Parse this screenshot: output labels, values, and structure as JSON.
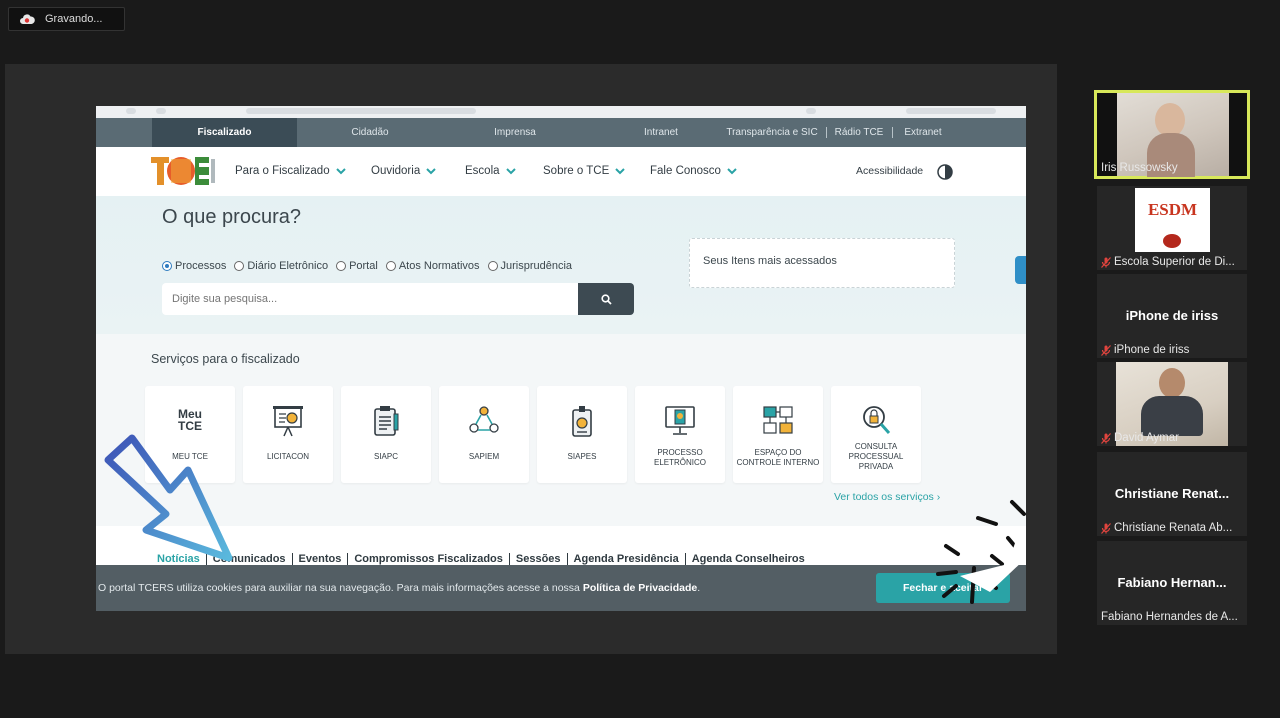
{
  "recording": {
    "label": "Gravando..."
  },
  "topnav": {
    "items": [
      "Fiscalizado",
      "Cidadão",
      "Imprensa",
      "Intranet",
      "Transparência e SIC",
      "Rádio TCE",
      "Extranet"
    ],
    "active": "Fiscalizado"
  },
  "mainnav": {
    "items": [
      "Para o Fiscalizado",
      "Ouvidoria",
      "Escola",
      "Sobre o TCE",
      "Fale Conosco"
    ],
    "accessibility": "Acessibilidade"
  },
  "hero": {
    "title": "O que procura?",
    "search_types": [
      "Processos",
      "Diário Eletrônico",
      "Portal",
      "Atos Normativos",
      "Jurisprudência"
    ],
    "selected_type": "Processos",
    "search_placeholder": "Digite sua pesquisa...",
    "favorites_title": "Seus Itens mais acessados"
  },
  "services": {
    "title": "Serviços para o fiscalizado",
    "cards": [
      "MEU TCE",
      "LICITACON",
      "SIAPC",
      "SAPIEM",
      "SIAPES",
      "PROCESSO ELETRÔNICO",
      "ESPAÇO DO CONTROLE INTERNO",
      "CONSULTA PROCESSUAL PRIVADA"
    ],
    "meu_tce_logo": "Meu TCE",
    "see_all": "Ver todos os serviços ›"
  },
  "news": {
    "tabs": [
      "Notícias",
      "Comunicados",
      "Eventos",
      "Compromissos Fiscalizados",
      "Sessões",
      "Agenda Presidência",
      "Agenda Conselheiros"
    ],
    "active": "Notícias"
  },
  "cookie": {
    "text": "O portal TCERS utiliza cookies para auxiliar na sua navegação. Para mais informações acesse a nossa ",
    "link": "Política de Privacidade",
    "end": ".",
    "button": "Fechar e aceitar"
  },
  "participants": [
    {
      "name": "Iris Russowsky",
      "muted": false
    },
    {
      "name": "Escola Superior de Di...",
      "muted": true,
      "logo": "ESDM"
    },
    {
      "name": "iPhone de iriss",
      "big": "iPhone de iriss",
      "muted": true
    },
    {
      "name": "David Aymar",
      "muted": true
    },
    {
      "name": "Christiane Renata Ab...",
      "big": "Christiane  Renat...",
      "muted": true
    },
    {
      "name": "Fabiano Hernandes de A...",
      "big": "Fabiano  Hernan...",
      "muted": false
    }
  ],
  "colors": {
    "accent": "#2aa3a6",
    "topnav": "#5a6b74",
    "active_speaker": "#d8e85a",
    "mute": "#e0443e"
  }
}
